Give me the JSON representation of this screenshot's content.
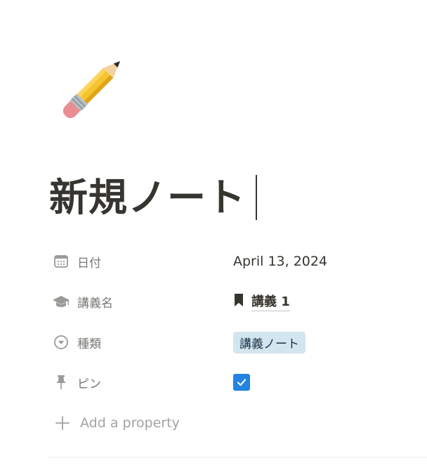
{
  "page": {
    "icon": "pencil-emoji",
    "title": "新規ノート"
  },
  "properties": [
    {
      "icon": "calendar-icon",
      "name": "日付",
      "value": "April 13, 2024"
    },
    {
      "icon": "graduation-cap-icon",
      "name": "講義名",
      "value": "講義 1",
      "value_icon": "bookmark-icon"
    },
    {
      "icon": "select-icon",
      "name": "種類",
      "value": "講義ノート",
      "tag_color": "#d3e5ef"
    },
    {
      "icon": "pin-icon",
      "name": "ピン",
      "checked": true,
      "checkbox_color": "#2383e2"
    }
  ],
  "add_property": {
    "icon": "plus-icon",
    "label": "Add a property"
  }
}
